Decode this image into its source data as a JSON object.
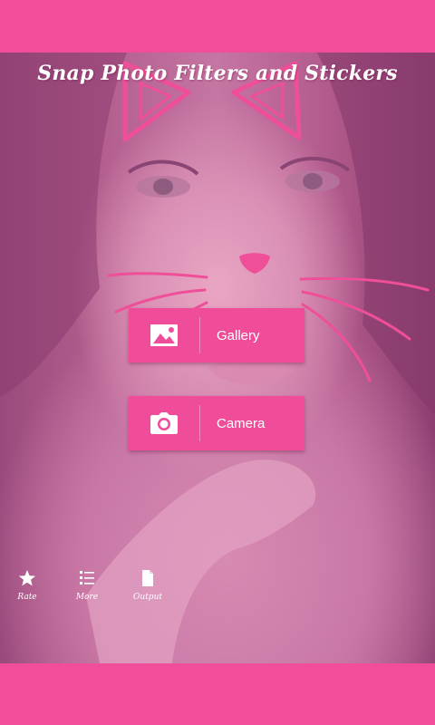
{
  "app": {
    "title": "Snap Photo Filters and Stickers"
  },
  "actions": {
    "gallery_label": "Gallery",
    "camera_label": "Camera"
  },
  "footer": {
    "rate_label": "Rate",
    "more_label": "More",
    "output_label": "Output"
  },
  "icons": {
    "gallery": "image-icon",
    "camera": "camera-icon",
    "rate": "star-icon",
    "more": "list-icon",
    "output": "document-icon"
  },
  "colors": {
    "brand_pink": "#f04e9b",
    "button_pink": "#ef4d99",
    "overlay_pink": "#c978a6",
    "text": "#ffffff"
  }
}
